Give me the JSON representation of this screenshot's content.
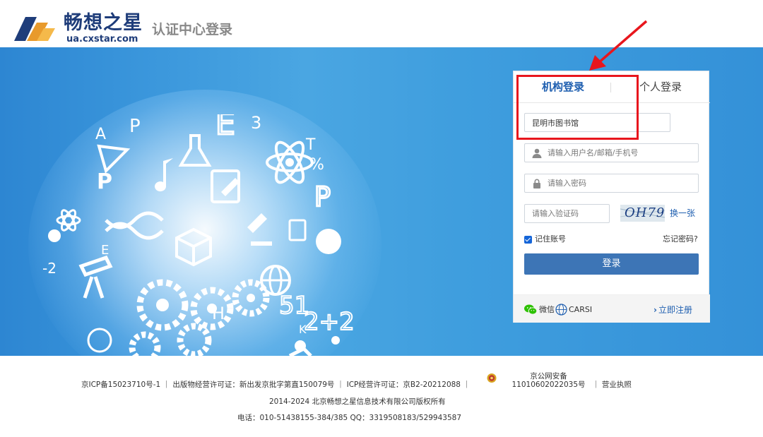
{
  "header": {
    "brand_name": "畅想之星",
    "brand_url": "ua.cxstar.com",
    "title": "认证中心登录"
  },
  "login_panel": {
    "tabs": [
      {
        "label": "机构登录",
        "active": true
      },
      {
        "label": "个人登录",
        "active": false
      }
    ],
    "org_field": {
      "value": "昆明市图书馆"
    },
    "username_field": {
      "placeholder": "请输入用户名/邮箱/手机号"
    },
    "password_field": {
      "placeholder": "请输入密码"
    },
    "captcha_field": {
      "placeholder": "请输入验证码"
    },
    "captcha_text": "OH79",
    "refresh_label": "换一张",
    "remember_label": "记住账号",
    "remember_checked": true,
    "forgot_label": "忘记密码?",
    "login_label": "登录",
    "wechat_label": "微信",
    "carsi_label": "CARSI",
    "register_label": "立即注册"
  },
  "footer": {
    "line1a": "京ICP备15023710号-1 ｜ 出版物经营许可证：新出发京批字第直150079号 ｜ ICP经营许可证：京B2-20212088 ｜",
    "police_line1": "京公网安备",
    "police_line2": "11010602022035号",
    "line1b": "｜ 营业执照",
    "line2": "2014-2024 北京畅想之星信息技术有限公司版权所有",
    "line3": "电话：010-51438155-384/385    QQ：3319508183/529943587"
  },
  "colors": {
    "brand": "#1f3d7a",
    "accent": "#1f5fb0",
    "button": "#3d75b6",
    "annotation": "#e8161d"
  }
}
